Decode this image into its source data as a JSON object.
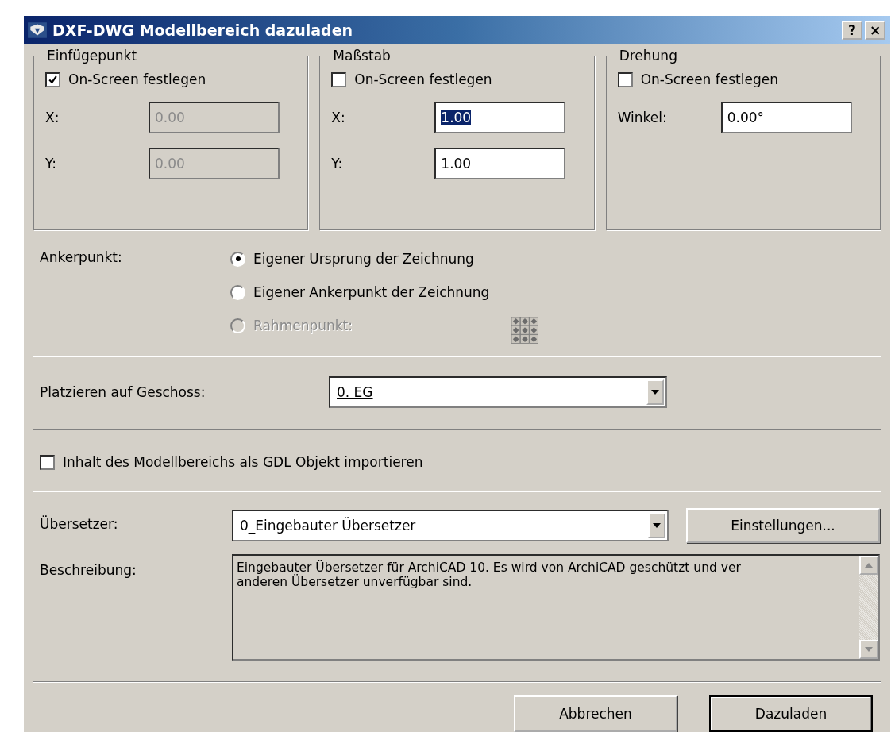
{
  "window": {
    "title": "DXF-DWG Modellbereich dazuladen",
    "help_button": "?",
    "close_button": "×"
  },
  "groups": [
    {
      "title": "Einfügepunkt",
      "on_screen": {
        "label": "On-Screen festlegen",
        "checked": true
      },
      "fields": [
        {
          "label": "X:",
          "value": "0.00",
          "disabled": true,
          "selected": false
        },
        {
          "label": "Y:",
          "value": "0.00",
          "disabled": true,
          "selected": false
        }
      ]
    },
    {
      "title": "Maßstab",
      "on_screen": {
        "label": "On-Screen festlegen",
        "checked": false
      },
      "fields": [
        {
          "label": "X:",
          "value": "1.00",
          "disabled": false,
          "selected": true
        },
        {
          "label": "Y:",
          "value": "1.00",
          "disabled": false,
          "selected": false
        }
      ]
    },
    {
      "title": "Drehung",
      "on_screen": {
        "label": "On-Screen festlegen",
        "checked": false
      },
      "fields": [
        {
          "label": "Winkel:",
          "value": "0.00°",
          "disabled": false,
          "selected": false
        }
      ]
    }
  ],
  "anchor": {
    "label": "Ankerpunkt:",
    "options": [
      {
        "label": "Eigener Ursprung der Zeichnung",
        "selected": true,
        "disabled": false
      },
      {
        "label": "Eigener Ankerpunkt der Zeichnung",
        "selected": false,
        "disabled": false
      },
      {
        "label": "Rahmenpunkt:",
        "selected": false,
        "disabled": true
      }
    ]
  },
  "storey": {
    "label": "Platzieren auf Geschoss:",
    "value": "0. EG"
  },
  "gdl_import": {
    "label": "Inhalt des Modellbereichs als GDL Objekt importieren",
    "checked": false
  },
  "translator": {
    "label": "Übersetzer:",
    "value": "0_Eingebauter Übersetzer",
    "settings_button": "Einstellungen..."
  },
  "description": {
    "label": "Beschreibung:",
    "lines": [
      "Eingebauter Übersetzer für ArchiCAD 10. Es wird von ArchiCAD geschützt und ver",
      "anderen Übersetzer unverfügbar sind."
    ]
  },
  "buttons": [
    {
      "label": "Abbrechen",
      "default": false
    },
    {
      "label": "Dazuladen",
      "default": true
    }
  ]
}
